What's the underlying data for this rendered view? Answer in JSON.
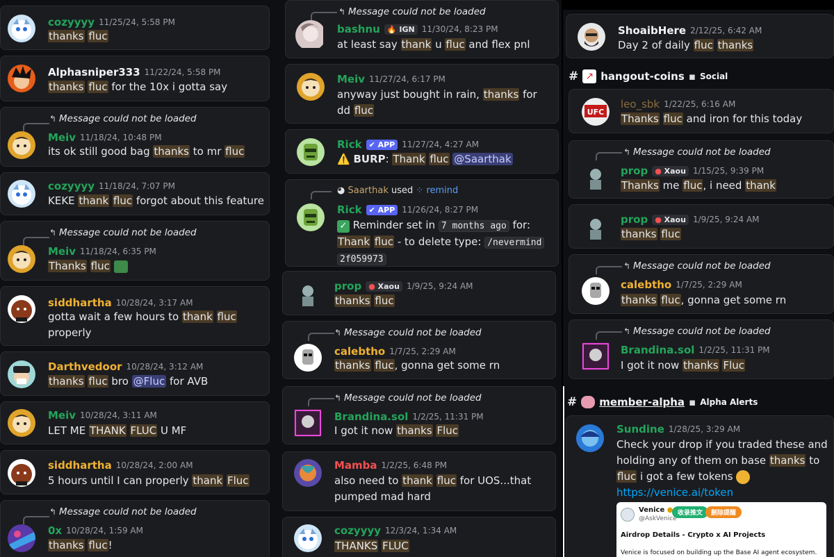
{
  "reply_text": "Message could not be loaded",
  "col1": [
    {
      "name": "cozyyyy",
      "ts": "11/25/24, 5:58 PM",
      "text": [
        "thanks",
        "fluc"
      ]
    },
    {
      "name": "Alphasniper333",
      "ts": "11/22/24, 5:58 PM",
      "text": [
        "thanks",
        "fluc",
        "for the 10x i gotta say"
      ]
    },
    {
      "name": "Meiv",
      "ts": "11/18/24, 10:48 PM",
      "text": "its ok still good bag thanks to mr fluc"
    },
    {
      "name": "cozyyyy",
      "ts": "11/18/24, 7:07 PM",
      "text": "KEKE thank fluc forgot about this feature"
    },
    {
      "name": "Meiv",
      "ts": "11/18/24, 6:35 PM",
      "text": "Thanks fluc"
    },
    {
      "name": "siddhartha",
      "ts": "10/28/24, 3:17 AM",
      "text": "gotta wait a few hours to thank fluc properly"
    },
    {
      "name": "Darthvedoor",
      "ts": "10/28/24, 3:12 AM",
      "text": "thanks fluc bro",
      "mention": "@Fluc",
      "tail": "for AVB"
    },
    {
      "name": "Meiv",
      "ts": "10/28/24, 3:11 AM",
      "text": "LET ME THANK FLUC U MF"
    },
    {
      "name": "siddhartha",
      "ts": "10/28/24, 2:00 AM",
      "text": "5 hours until I can properly thank Fluc"
    },
    {
      "name": "0x",
      "ts": "10/28/24, 1:59 AM",
      "text": "thanks fluc!"
    }
  ],
  "col2": [
    {
      "name": "bashnu",
      "tag": "IGN",
      "ts": "11/30/24, 8:23 PM",
      "text": "at least say thank u fluc and flex pnl"
    },
    {
      "name": "Meiv",
      "ts": "11/27/24, 6:17 PM",
      "text": "anyway just bought in rain, thanks for dd fluc"
    },
    {
      "name": "Rick",
      "app": "APP",
      "ts": "11/27/24, 4:27 AM",
      "bold": "BURP",
      "text": "Thank fluc",
      "mention": "@Saarthak"
    },
    {
      "name": "Rick",
      "app": "APP",
      "ts": "11/26/24, 8:27 PM",
      "used_by": "Saarthak",
      "used_word": "used",
      "cmd": "remind",
      "text_a": "Reminder set in",
      "when": "7 months ago",
      "text_b": "for:",
      "text_c": "Thank fluc - to delete type:",
      "code1": "/nevermind",
      "code2": "2f059973"
    },
    {
      "name": "prop",
      "tag": "Xaou",
      "ts": "1/9/25, 9:24 AM",
      "text": "thanks fluc"
    },
    {
      "name": "calebtho",
      "ts": "1/7/25, 2:29 AM",
      "text": "thanks fluc, gonna get some rn"
    },
    {
      "name": "Brandina.sol",
      "ts": "1/2/25, 11:31 PM",
      "text": "I got it now thanks Fluc"
    },
    {
      "name": "Mamba",
      "ts": "1/2/25, 6:48 PM",
      "text": "also need to thank fluc for UOS...that pumped mad hard"
    },
    {
      "name": "cozyyyy",
      "ts": "12/3/24, 1:34 AM",
      "text": "THANKS FLUC"
    }
  ],
  "col3": {
    "top": {
      "name": "ShoaibHere",
      "ts": "2/12/25, 6:42 AM",
      "text": "Day 2 of daily fluc thanks"
    },
    "channel1": {
      "name": "hangout-coins",
      "sub": "Social"
    },
    "msgs": [
      {
        "name": "leo_sbk",
        "ts": "1/22/25, 6:16 AM",
        "text": "Thanks fluc and iron for this today"
      },
      {
        "name": "prop",
        "tag": "Xaou",
        "ts": "1/15/25, 9:39 PM",
        "text": "Thanks me fluc, i need thank"
      },
      {
        "name": "prop",
        "tag": "Xaou",
        "ts": "1/9/25, 9:24 AM",
        "text": "thanks fluc"
      },
      {
        "name": "calebtho",
        "ts": "1/7/25, 2:29 AM",
        "text": "thanks fluc, gonna get some rn"
      },
      {
        "name": "Brandina.sol",
        "ts": "1/2/25, 11:31 PM",
        "text": "I got it now thanks Fluc"
      }
    ],
    "channel2": {
      "name": "member-alpha",
      "sub": "Alpha Alerts"
    },
    "sundine": {
      "name": "Sundine",
      "ts": "1/28/25, 3:29 AM",
      "text": "Check your drop if you traded these and holding any of them on base thanks to fluc i got a few tokens",
      "link": "https://venice.ai/token"
    },
    "embed": {
      "brand": "Venice",
      "handle": "@AskVenice",
      "pill1": "收录推文",
      "pill2": "删除提醒",
      "title": "Airdrop Details - Crypto x AI Projects",
      "body": "Venice is focused on building up the Base AI agent ecosystem."
    }
  },
  "colors": {
    "green": "#23a55a",
    "yellow": "#f0b232",
    "red": "#f25151",
    "highlight": "#4a3b26",
    "link": "#00a8fc"
  }
}
